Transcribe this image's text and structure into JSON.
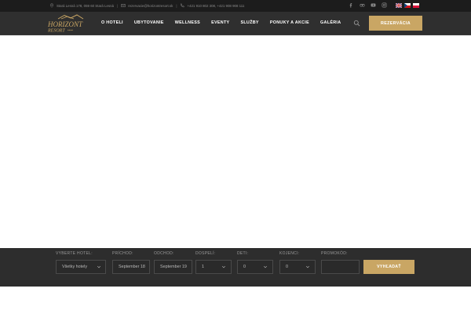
{
  "topbar": {
    "address": "Stará Lesná 178, 059 60 Stará Lesná",
    "email": "rezervacie@horizontresort.sk",
    "phones": "+421 910 802 308, +421 908 908 111",
    "social_icons": [
      "facebook-icon",
      "tripadvisor-icon",
      "youtube-icon",
      "instagram-icon"
    ],
    "flags": [
      "flag-en",
      "flag-cz",
      "flag-pl"
    ]
  },
  "header": {
    "logo": {
      "line1": "HORIZONT",
      "line2": "RESORT",
      "stars": "****"
    },
    "nav": [
      "O HOTELI",
      "UBYTOVANIE",
      "WELLNESS",
      "EVENTY",
      "SLUŽBY",
      "PONUKY A AKCIE",
      "GALÉRIA"
    ],
    "reservation_button": "REZERVÁCIA"
  },
  "booking": {
    "hotel": {
      "label": "VYBERTE HOTEL:",
      "value": "Všetky hotely"
    },
    "arrival": {
      "label": "PRÍCHOD:",
      "value": "September 18"
    },
    "departure": {
      "label": "ODCHOD:",
      "value": "September 19"
    },
    "adults": {
      "label": "DOSPELÍ:",
      "value": "1"
    },
    "children": {
      "label": "DETI:",
      "value": "0"
    },
    "infants": {
      "label": "KOJENCI:",
      "value": "0"
    },
    "promo": {
      "label": "PROMOKÓD:",
      "value": ""
    },
    "search_button": "VYHĽADAŤ"
  },
  "colors": {
    "accent": "#c9a664",
    "topbar_bg": "#1c1c1c",
    "header_bg": "#2f2f2f",
    "booking_bg": "#2d2d2d"
  }
}
